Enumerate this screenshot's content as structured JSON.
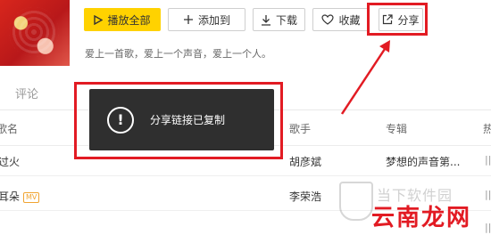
{
  "toolbar": {
    "play_all": "播放全部",
    "add_to": "添加到",
    "download": "下载",
    "collect": "收藏",
    "share": "分享"
  },
  "slogan": "爱上一首歌，爱上一个声音，爱上一个人。",
  "tabs": {
    "comment": "评论"
  },
  "table": {
    "headers": {
      "song": "歌名",
      "singer": "歌手",
      "album": "专辑",
      "heat": "热"
    },
    "rows": [
      {
        "song": "过火",
        "mv": "",
        "singer": "胡彦斌",
        "album": "梦想的声音第..."
      },
      {
        "song": "耳朵",
        "mv": "MV",
        "singer": "李荣浩",
        "album": ""
      },
      {
        "song": "",
        "mv": "",
        "singer": "",
        "album": ""
      }
    ]
  },
  "toast": {
    "message": "分享链接已复制",
    "icon": "exclamation-circle-icon"
  },
  "watermark": {
    "line1": "当下软件园",
    "brand": "云南龙网"
  },
  "colors": {
    "accent_yellow": "#ffd200",
    "highlight_red": "#e21b23",
    "toast_bg": "#2f2f2f"
  }
}
